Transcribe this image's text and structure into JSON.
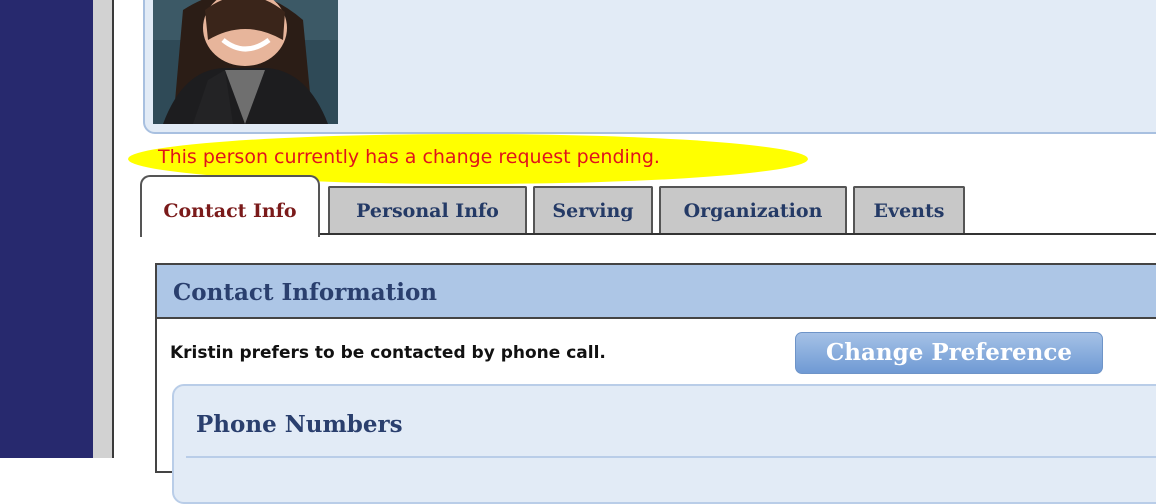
{
  "notice": {
    "pending_text": "This person currently has a change request pending."
  },
  "tabs": [
    {
      "label": "Contact Info",
      "active": true
    },
    {
      "label": "Personal Info",
      "active": false
    },
    {
      "label": "Serving",
      "active": false
    },
    {
      "label": "Organization",
      "active": false
    },
    {
      "label": "Events",
      "active": false
    }
  ],
  "contact_section": {
    "title": "Contact Information",
    "preference_text": "Kristin prefers to be contacted by phone call.",
    "change_button_label": "Change Preference"
  },
  "phone_section": {
    "title": "Phone Numbers"
  },
  "colors": {
    "rail": "#27296e",
    "highlight": "#ffff00",
    "pending_text": "#e0141b",
    "section_header": "#adc6e6",
    "button": "#6f9ad4"
  }
}
